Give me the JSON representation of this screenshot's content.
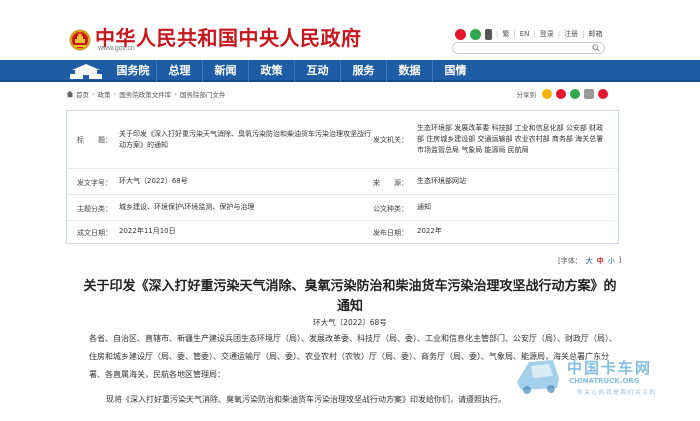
{
  "header": {
    "site_title": "中华人民共和国中央人民政府",
    "domain": "www.gov.cn",
    "links": [
      "繁",
      "EN",
      "登录",
      "注册",
      "邮箱"
    ],
    "icons": [
      "weibo-icon",
      "wechat-icon",
      "mobile-icon"
    ]
  },
  "nav": {
    "items": [
      "国务院",
      "总理",
      "新闻",
      "政策",
      "互动",
      "服务",
      "数据",
      "国情"
    ]
  },
  "breadcrumb": {
    "items": [
      "首页",
      "政策",
      "国务院政策文件库",
      "国务院部门文件"
    ],
    "share_label": "分享到"
  },
  "info": {
    "title_label": "标　　题：",
    "title_value": "关于印发《深入打好重污染天气消除、臭氧污染防治和柴油货车污染治理攻坚战行动方案》的通知",
    "issuer_label": "发文机关：",
    "issuer_value": "生态环境部 发展改革委 科技部 工业和信息化部 公安部 财政部 住房城乡建设部 交通运输部 农业农村部 商务部 海关总署 市场监管总局 气象局 能源局 民航局",
    "docnum_label": "发文字号：",
    "docnum_value": "环大气〔2022〕68号",
    "source_label": "来　　源：",
    "source_value": "生态环境部网站",
    "category_label": "主题分类：",
    "category_value": "城乡建设、环境保护\\环境监测、保护与治理",
    "type_label": "公文种类：",
    "type_value": "通知",
    "written_label": "成文日期：",
    "written_value": "2022年11月10日",
    "published_label": "发布日期：",
    "published_value": "2022年"
  },
  "font_size": {
    "label": "[字体：",
    "large": "大",
    "medium": "中",
    "small": "小",
    "close": "]"
  },
  "article": {
    "title": "关于印发《深入打好重污染天气消除、臭氧污染防治和柴油货车污染治理攻坚战行动方案》的通知",
    "doc_number": "环大气〔2022〕68号",
    "para1": "各省、自治区、直辖市、新疆生产建设兵团生态环境厅（局）、发展改革委、科技厅（局、委）、工业和信息化主管部门、公安厅（局）、财政厅（局）、住房和城乡建设厅（局、委、管委）、交通运输厅（局、委）、农业农村（农牧）厅（局、委）、商务厅（局、委）、气象局、能源局，海关总署广东分署、各直属海关，民航各地区管理局：",
    "para2": "现将《深入打好重污染天气消除、臭氧污染防治和柴油货车污染治理攻坚战行动方案》印发给你们，请遵照执行。"
  },
  "watermark": {
    "text": "中国卡车网",
    "sub": "CHINATRUCK.ORG",
    "sub2": "你 关 心 的 就 是 我 们 关 注 的"
  },
  "colors": {
    "brand_red": "#c8161e",
    "nav_blue": "#1e5da5"
  }
}
